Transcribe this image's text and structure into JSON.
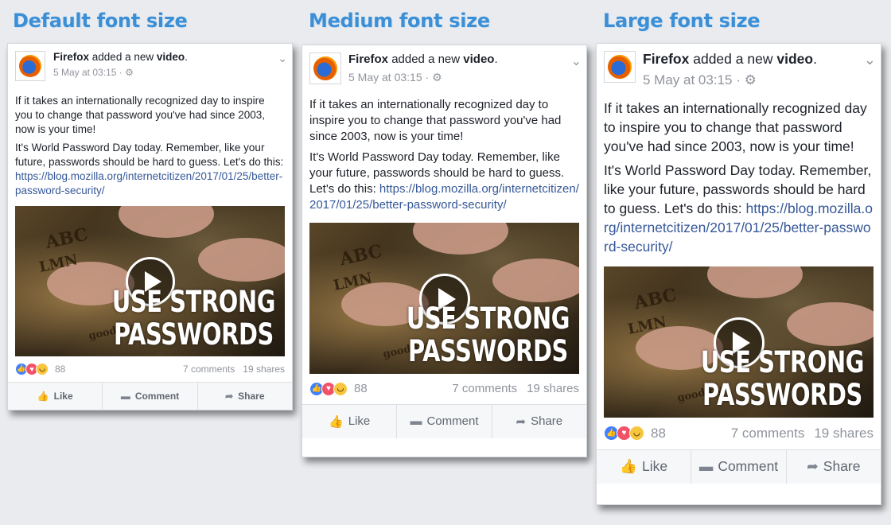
{
  "headings": [
    "Default font size",
    "Medium font size",
    "Large font size"
  ],
  "post": {
    "author": "Firefox",
    "action_pre": "added a new",
    "action_obj": "video",
    "action_post": ".",
    "timestamp": "5 May at 03:15",
    "audience_sep": "·",
    "para1": "If it takes an internationally recognized day to inspire you to change that password you've had since 2003, now is your time!",
    "para2": "It's World Password Day today. Remember, like your future, passwords should be hard to guess. Let's do this:",
    "link": "https://blog.mozilla.org/internetcitizen/2017/01/25/better-password-security/",
    "video_text_1": "USE STRONG",
    "video_text_2": "PASSWORDS",
    "board_letters": "ABC",
    "board_letters_2": "LMN",
    "board_letters_3": "good bye",
    "reactions_count": "88",
    "comments": "7 comments",
    "shares": "19 shares",
    "like_label": "Like",
    "comment_label": "Comment",
    "share_label": "Share"
  },
  "icons": {
    "logo": "firefox-logo",
    "gear": "gear-icon",
    "chevron": "chevron-down-icon",
    "play": "play-icon",
    "like": "thumbs-up-icon",
    "comment": "comment-icon",
    "share": "share-arrow-icon"
  },
  "colors": {
    "heading": "#3b8fd6",
    "link": "#365899",
    "background": "#e9ebee"
  }
}
